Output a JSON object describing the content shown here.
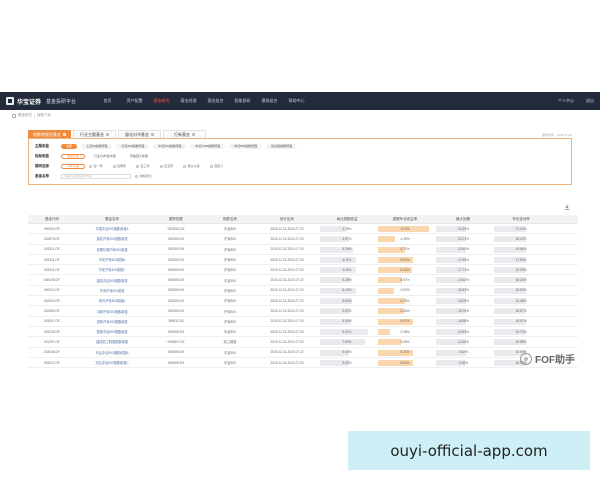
{
  "header": {
    "logo_text": "华宝证券",
    "platform": "基金投研平台",
    "nav": [
      "首页",
      "资产配置",
      "基金研究",
      "基金经理",
      "基金组合",
      "智能投研",
      "模拟组合",
      "帮助中心"
    ],
    "active_nav_index": 2,
    "right": [
      "个人中心",
      "退出"
    ]
  },
  "breadcrumb": [
    "基金研究",
    "指数产品"
  ],
  "tabs": {
    "items": [
      "指数增强型基金",
      "行业主题基金",
      "量化对冲基金",
      "打新基金"
    ],
    "active_index": 0,
    "update_note": "更新时间：2021.07.20"
  },
  "filters": {
    "theme": {
      "label": "主题类型",
      "options": [
        "全部",
        "上证50指数增强",
        "沪深300指数增强",
        "中证500指数增强",
        "中证1000指数增强",
        "中证800指数增强",
        "创业板指数增强"
      ],
      "active_index": 0
    },
    "indicator": {
      "label": "指标类型",
      "options": [
        "收益表现",
        "行业分布/集中度",
        "风格因子暴露"
      ],
      "active_index": 0
    },
    "period": {
      "label": "期间选择",
      "options": [
        "今年以来",
        "近一年",
        "近两年",
        "近三年",
        "近五年",
        "成立以来",
        "自定义"
      ],
      "active_index": 0
    },
    "search": {
      "label": "基金名称",
      "placeholder": "请输入基金名称/代码",
      "button": "添加对比"
    }
  },
  "table": {
    "columns": [
      "基金代码",
      "基金名称",
      "跟踪指数",
      "指数名称",
      "统计区间",
      "每日超额收益",
      "超额年化收益率",
      "最大回撤",
      "年化波动率"
    ],
    "rows": [
      [
        "000942.OF",
        "华宝中证500指数增强A",
        "000905.CSI",
        "中证500",
        "2020.12.31-2021.07.20",
        "4.39%",
        "13.0%",
        "-10.39%",
        "17.24%"
      ],
      [
        "002670.OF",
        "建信沪深300指数增强",
        "000300.SH",
        "沪深300",
        "2020.12.31-2021.07.20",
        "4.97%",
        "4.39%",
        "-14.71%",
        "18.12%"
      ],
      [
        "003311.OF",
        "景顺长城沪深300增强",
        "000300.SH",
        "沪深300",
        "2020.12.31-2021.07.20",
        "5.76%",
        "6.71%",
        "-13.40%",
        "19.84%"
      ],
      [
        "002311.OF",
        "华安沪深300增强A",
        "000300.SH",
        "沪深300",
        "2020.12.31-2021.07.20",
        "6.11%",
        "8.53%",
        "-17.68%",
        "17.50%"
      ],
      [
        "003312.OF",
        "华安沪深300增强C",
        "000300.SH",
        "沪深300",
        "2020.12.31-2021.07.20",
        "6.11%",
        "8.43%",
        "-17.71%",
        "23.09%"
      ],
      [
        "000478.OF",
        "建信中证500指数增强",
        "000905.SH",
        "中证500",
        "2020.12.31-2021.07.20",
        "5.28%",
        "5.97%",
        "-10.62%",
        "18.24%"
      ],
      [
        "000312.OF",
        "华安沪深300增强",
        "000300.SH",
        "沪深300",
        "2020.12.31-2021.07.20",
        "6.12%",
        "3.90%",
        "-16.53%",
        "18.52%"
      ],
      [
        "002510.OF",
        "申万沪深300增强A",
        "000300.SH",
        "沪深300",
        "2020.12.31-2021.07.20",
        "5.54%",
        "6.76%",
        "-15.08%",
        "20.48%"
      ],
      [
        "002650.OF",
        "中欧沪深300指数增强",
        "000300.SH",
        "沪深300",
        "2020.12.31-2021.07.20",
        "5.07%",
        "6.44%",
        "-15.76%",
        "18.67%"
      ],
      [
        "003007.OF",
        "招商沪深300指数增强",
        "399012.SZ",
        "沪深300",
        "2020.12.31-2021.07.20",
        "5.30%",
        "8.57%",
        "-16.98%",
        "18.07%"
      ],
      [
        "003133.OF",
        "国泰中证500指数增强",
        "000905.SH",
        "中证500",
        "2020.12.31-2021.07.20",
        "8.21%",
        "3.08%",
        "-10.93%",
        "18.74%"
      ],
      [
        "001297.OF",
        "建信精工制造指数增强",
        "000819.CSI",
        "精工制造",
        "2020.12.31-2021.07.20",
        "7.84%",
        "5.65%",
        "-14.36%",
        "19.58%"
      ],
      [
        "003016.OF",
        "天弘中证500指数增强A",
        "000905.SH",
        "中证500",
        "2020.12.31-2021.07.20",
        "5.02%",
        "8.71%",
        "-9.62%",
        "15.59%"
      ],
      [
        "003017.OF",
        "天弘中证500指数增强C",
        "000905.SH",
        "中证500",
        "2020.12.31-2021.07.20",
        "5.02%",
        "8.53%",
        "-9.65%",
        "15.57%"
      ]
    ],
    "bar_fractions": {
      "daily_excess": [
        0.48,
        0.54,
        0.62,
        0.66,
        0.66,
        0.57,
        0.66,
        0.6,
        0.55,
        0.57,
        0.88,
        0.84,
        0.54,
        0.54
      ],
      "annual_excess": [
        0.95,
        0.32,
        0.5,
        0.64,
        0.63,
        0.45,
        0.29,
        0.5,
        0.48,
        0.64,
        0.23,
        0.42,
        0.65,
        0.64
      ]
    }
  },
  "watermark": "FOF助手",
  "banner": {
    "text": "ouyi-official-app.com"
  },
  "colors": {
    "accent": "#f08a3c",
    "topbar": "#232a3b",
    "active_nav": "#f25b4b",
    "banner": "#cfeff6"
  },
  "icons": {
    "export": "download-icon",
    "logo": "logo-icon",
    "breadcrumb": "home-icon",
    "watermark": "wechat-icon"
  }
}
